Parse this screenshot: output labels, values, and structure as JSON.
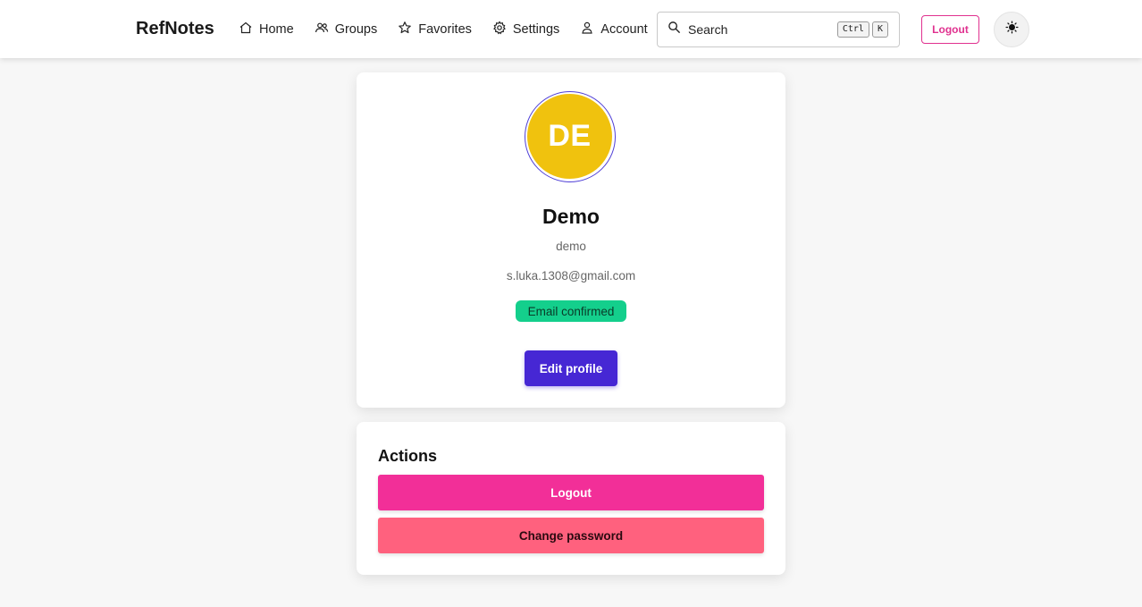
{
  "app": {
    "title": "RefNotes"
  },
  "nav": {
    "items": [
      {
        "label": "Home",
        "icon": "home-icon"
      },
      {
        "label": "Groups",
        "icon": "users-icon"
      },
      {
        "label": "Favorites",
        "icon": "star-icon"
      },
      {
        "label": "Settings",
        "icon": "gear-icon"
      },
      {
        "label": "Account",
        "icon": "user-icon"
      }
    ]
  },
  "search": {
    "label": "Search",
    "shortcut": [
      "Ctrl",
      "K"
    ],
    "icon": "search-icon"
  },
  "header": {
    "logout_label": "Logout",
    "theme_icon": "sun-icon"
  },
  "profile": {
    "initials": "DE",
    "display_name": "Demo",
    "username": "demo",
    "email": "s.luka.1308@gmail.com",
    "badge": "Email confirmed",
    "edit_label": "Edit profile",
    "avatar_color": "#f0c20e"
  },
  "actions": {
    "title": "Actions",
    "logout_label": "Logout",
    "change_password_label": "Change password"
  },
  "colors": {
    "primary": "#4627d4",
    "accent_pink": "#f22f98",
    "danger_pink": "#ff617e",
    "success": "#14cf8c"
  }
}
